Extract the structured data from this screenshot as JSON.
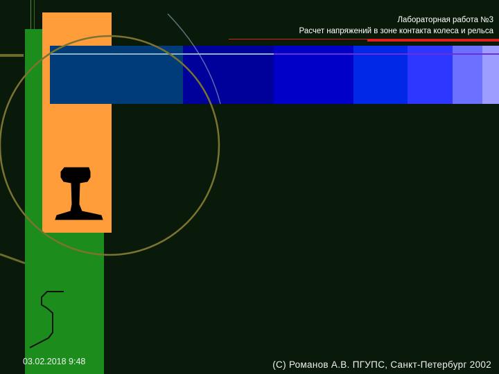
{
  "header": {
    "line1": "Лабораторная работа №3",
    "line2": "Расчет напряжений в зоне контакта колеса и рельса"
  },
  "footer": {
    "date": "03.02.2018 9:48",
    "credit": "(C) Романов А.В. ПГУПС, Санкт-Петербург 2002"
  },
  "colors": {
    "background": "#0a1a0a",
    "green_bar": "#1c8c1c",
    "orange_panel": "#ff9d3b",
    "arc": "#7a7430",
    "accent_red": "#e0201c",
    "stripes": [
      "#003c78",
      "#00009b",
      "#0000c8",
      "#0028e6",
      "#2e37ff",
      "#6c70ff",
      "#9d9dff"
    ]
  },
  "icons": {
    "rail_profile": "rail-profile-icon",
    "channel_profile": "channel-profile-icon"
  }
}
